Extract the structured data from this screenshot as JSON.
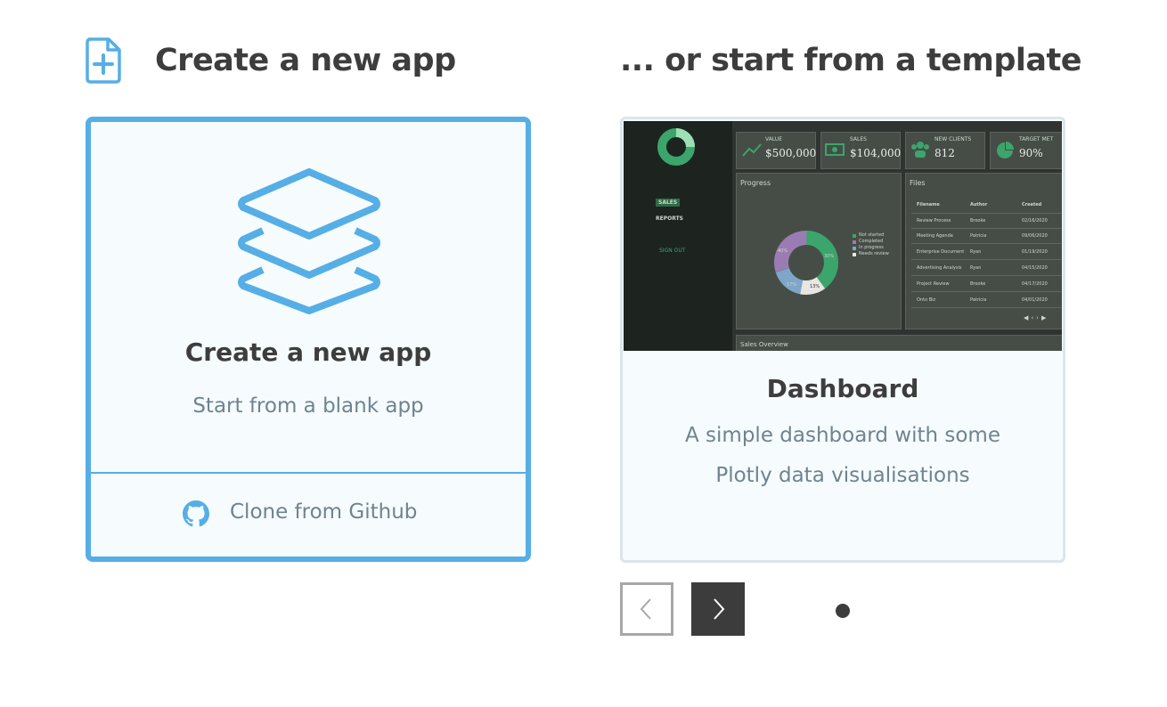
{
  "new_app_section": {
    "heading": "Create a new app",
    "card": {
      "title": "Create a new app",
      "subtitle": "Start from a blank app",
      "clone_label": "Clone from Github"
    }
  },
  "template_section": {
    "heading": "... or start from a template",
    "template": {
      "title": "Dashboard",
      "description_line1": "A simple dashboard with some",
      "description_line2": "Plotly data visualisations",
      "preview": {
        "kpis": [
          {
            "label": "VALUE",
            "value": "$500,000"
          },
          {
            "label": "SALES",
            "value": "$104,000"
          },
          {
            "label": "NEW CLIENTS",
            "value": "812"
          },
          {
            "label": "TARGET MET",
            "value": "90%"
          }
        ],
        "nav": [
          "SALES",
          "REPORTS",
          "SIGN OUT"
        ],
        "progress_title": "Progress",
        "files_title": "Files",
        "overview_title": "Sales Overview",
        "legend": [
          "Not started",
          "Completed",
          "In progress",
          "Needs review"
        ],
        "file_headers": [
          "Filename",
          "Author",
          "Created"
        ],
        "files": [
          [
            "Review Process",
            "Brooke",
            "02/16/2020"
          ],
          [
            "Meeting Agenda",
            "Patricia",
            "09/06/2020"
          ],
          [
            "Enterprise Document",
            "Ryan",
            "01/19/2020"
          ],
          [
            "Advertising Analysis",
            "Ryan",
            "04/15/2020"
          ],
          [
            "Project Review",
            "Brooke",
            "04/17/2020"
          ],
          [
            "Onto Biz",
            "Patricia",
            "04/01/2020"
          ]
        ],
        "donut_labels": [
          "30%",
          "40%",
          "17%",
          "13%"
        ]
      }
    },
    "carousel": {
      "current": 1,
      "total": 1
    }
  },
  "colors": {
    "accent": "#56aee6",
    "dark": "#3c3c3c",
    "muted": "#6f8390"
  }
}
